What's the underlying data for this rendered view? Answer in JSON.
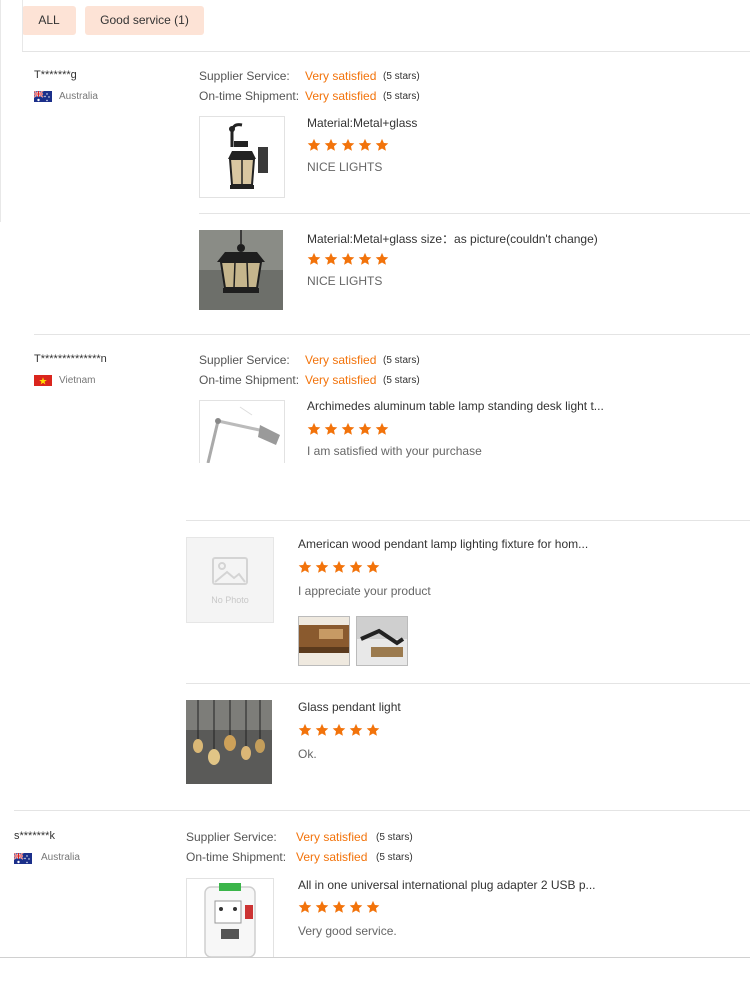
{
  "filters": {
    "all": "ALL",
    "good_service": "Good service (1)"
  },
  "accent": "#f2730b",
  "labels": {
    "supplier": "Supplier Service:",
    "shipment": "On-time Shipment:"
  },
  "reviews": [
    {
      "user": "T*******g",
      "country": "Australia",
      "supplier_rating": "Very satisfied",
      "supplier_stars": "(5 stars)",
      "shipment_rating": "Very satisfied",
      "shipment_stars": "(5 stars)",
      "products": [
        {
          "title": "Material:Metal+glass",
          "rating": 5,
          "comment": "NICE LIGHTS"
        },
        {
          "title": "Material:Metal+glass size：as picture(couldn't change)",
          "rating": 5,
          "comment": "NICE LIGHTS"
        }
      ]
    },
    {
      "user": "T**************n",
      "country": "Vietnam",
      "supplier_rating": "Very satisfied",
      "supplier_stars": "(5 stars)",
      "shipment_rating": "Very satisfied",
      "shipment_stars": "(5 stars)",
      "products": [
        {
          "title": "Archimedes aluminum table lamp standing desk light t...",
          "rating": 5,
          "comment": "I am satisfied with your purchase"
        },
        {
          "title": "American wood pendant lamp lighting fixture for hom...",
          "rating": 5,
          "comment": "I appreciate your product",
          "no_photo": "No Photo"
        },
        {
          "title": "Glass pendant light",
          "rating": 5,
          "comment": "Ok."
        }
      ]
    },
    {
      "user": "s*******k",
      "country": "Australia",
      "supplier_rating": "Very satisfied",
      "supplier_stars": "(5 stars)",
      "shipment_rating": "Very satisfied",
      "shipment_stars": "(5 stars)",
      "products": [
        {
          "title": "All in one universal international plug adapter 2 USB p...",
          "rating": 5,
          "comment": "Very good service."
        }
      ]
    }
  ]
}
